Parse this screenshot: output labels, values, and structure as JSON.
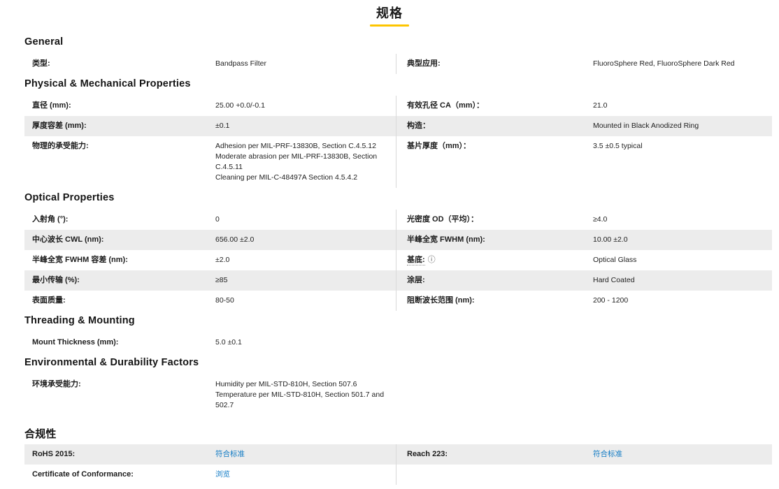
{
  "page": {
    "title": "规格",
    "accent_color": "#fdc500",
    "link_color": "#0f7ac4",
    "shaded_row_color": "#ececec"
  },
  "sections": [
    {
      "id": "general",
      "title": "General",
      "zh": false,
      "rows": [
        {
          "shaded": false,
          "left": {
            "label": "类型:",
            "value": "Bandpass Filter"
          },
          "right": {
            "label": "典型应用:",
            "value": "FluoroSphere Red, FluoroSphere Dark Red"
          }
        }
      ]
    },
    {
      "id": "physical",
      "title": "Physical & Mechanical Properties",
      "zh": false,
      "rows": [
        {
          "shaded": false,
          "left": {
            "label": "直径 (mm):",
            "value": "25.00 +0.0/-0.1"
          },
          "right": {
            "label": "有效孔径 CA（mm）：",
            "value": "21.0"
          }
        },
        {
          "shaded": true,
          "left": {
            "label": "厚度容差 (mm):",
            "value": "±0.1"
          },
          "right": {
            "label": "构造：",
            "value": "Mounted in Black Anodized Ring"
          }
        },
        {
          "shaded": false,
          "left": {
            "label": "物理的承受能力:",
            "value": "Adhesion per MIL-PRF-13830B, Section C.4.5.12\nModerate abrasion per MIL-PRF-13830B, Section C.4.5.11\nCleaning per MIL-C-48497A Section 4.5.4.2"
          },
          "right": {
            "label": "基片厚度（mm）：",
            "value": "3.5 ±0.5 typical"
          }
        }
      ]
    },
    {
      "id": "optical",
      "title": "Optical Properties",
      "zh": false,
      "rows": [
        {
          "shaded": false,
          "left": {
            "label": "入射角 (°):",
            "value": "0"
          },
          "right": {
            "label": "光密度 OD（平均）：",
            "value": "≥4.0"
          }
        },
        {
          "shaded": true,
          "left": {
            "label": "中心波长 CWL (nm):",
            "value": "656.00 ±2.0"
          },
          "right": {
            "label": "半峰全宽 FWHM (nm):",
            "value": "10.00 ±2.0"
          }
        },
        {
          "shaded": false,
          "left": {
            "label": "半峰全宽 FWHM 容差 (nm):",
            "value": "±2.0"
          },
          "right": {
            "label": "基底:",
            "value": "Optical Glass",
            "info": true,
            "info_icon": "ⓘ"
          }
        },
        {
          "shaded": true,
          "left": {
            "label": "最小传输 (%):",
            "value": "≥85"
          },
          "right": {
            "label": "涂层:",
            "value": "Hard Coated"
          }
        },
        {
          "shaded": false,
          "left": {
            "label": "表面质量:",
            "value": "80-50"
          },
          "right": {
            "label": "阻断波长范围 (nm):",
            "value": "200 - 1200"
          }
        }
      ]
    },
    {
      "id": "threading",
      "title": "Threading & Mounting",
      "zh": false,
      "rows": [
        {
          "shaded": false,
          "left": {
            "label": "Mount Thickness (mm):",
            "value": "5.0 ±0.1"
          }
        }
      ]
    },
    {
      "id": "environmental",
      "title": "Environmental & Durability Factors",
      "zh": false,
      "rows": [
        {
          "shaded": false,
          "left": {
            "label": "环境承受能力:",
            "value": "Humidity per MIL-STD-810H, Section 507.6\nTemperature per MIL-STD-810H, Section 501.7 and 502.7"
          }
        }
      ]
    },
    {
      "id": "compliance",
      "title": "合规性",
      "zh": true,
      "rows": [
        {
          "shaded": true,
          "left": {
            "label": "RoHS 2015:",
            "value": "符合标准",
            "link": true,
            "link_name": "rohs-2015-link"
          },
          "right": {
            "label": "Reach 223:",
            "value": "符合标准",
            "link": true,
            "link_name": "reach-223-link"
          }
        },
        {
          "shaded": false,
          "left": {
            "label": "Certificate of Conformance:",
            "value": "浏览",
            "link": true,
            "link_name": "certificate-of-conformance-link"
          }
        }
      ]
    }
  ]
}
